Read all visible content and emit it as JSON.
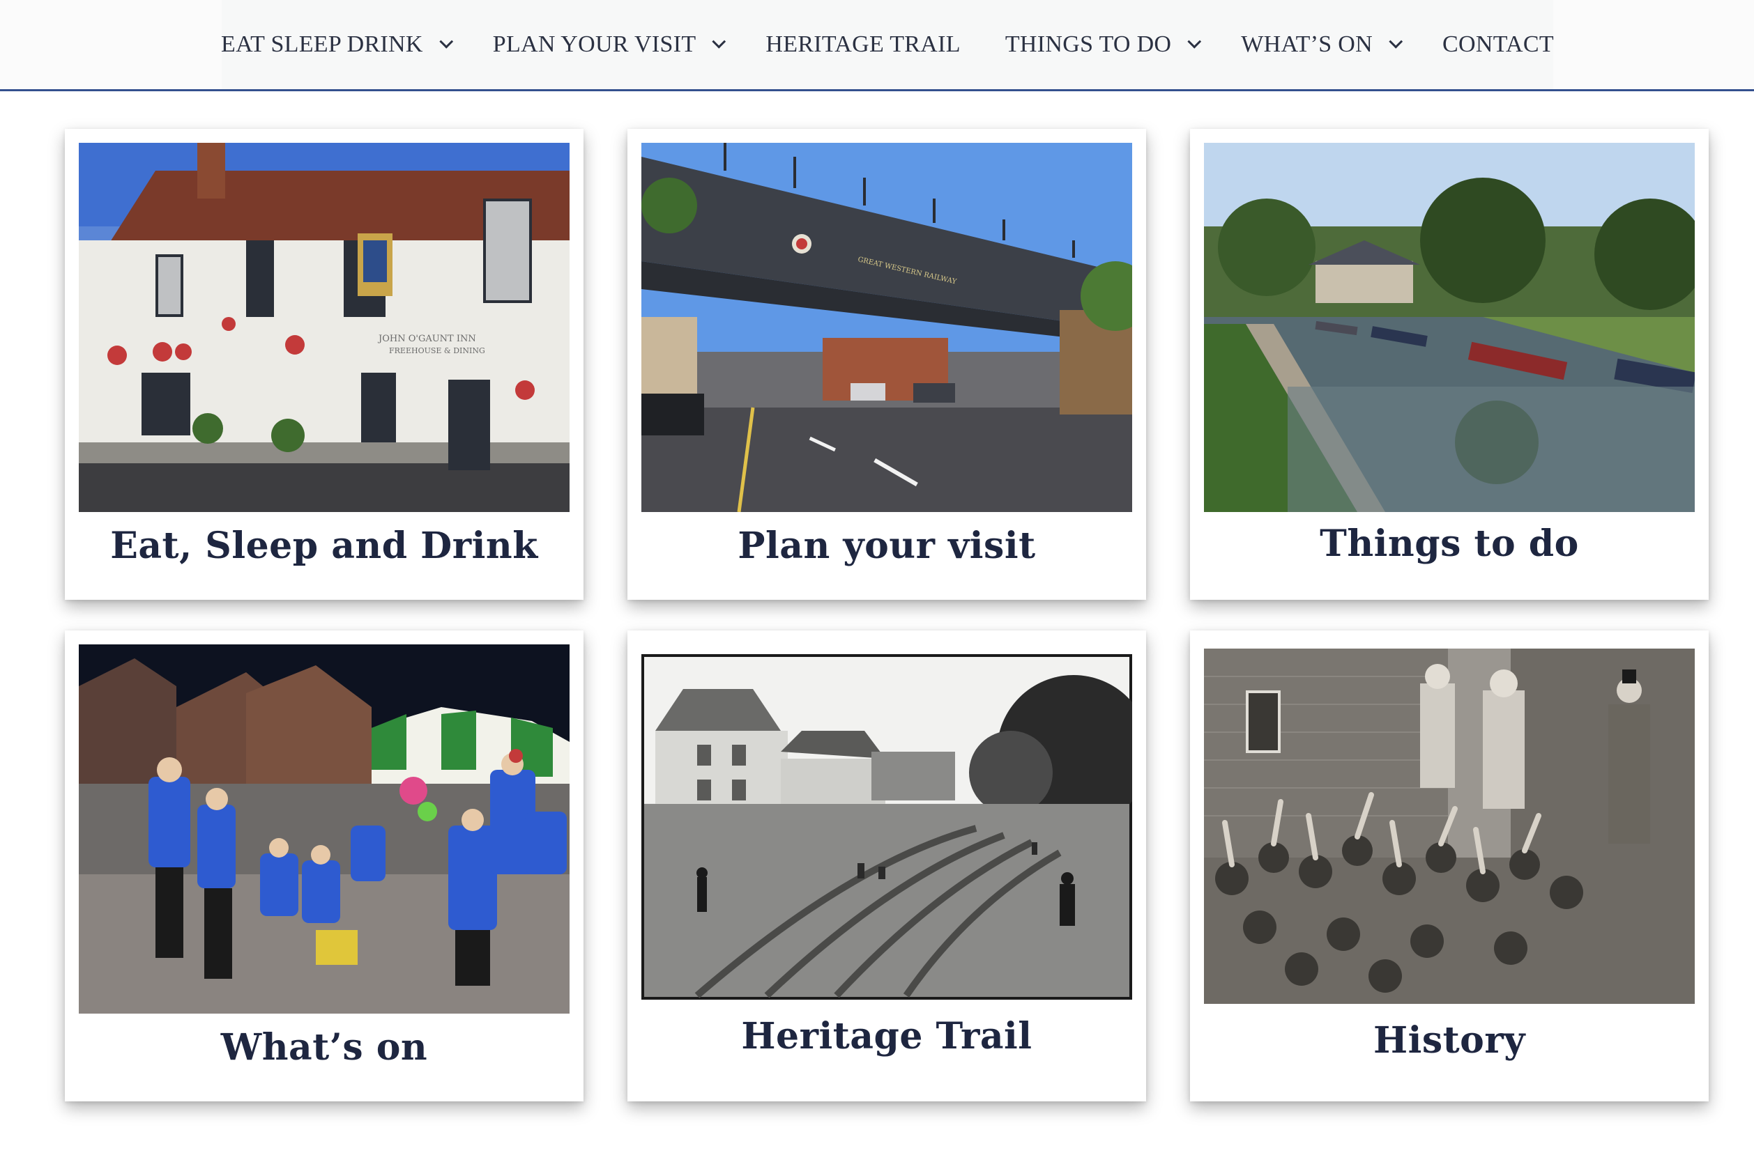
{
  "nav": {
    "items": [
      {
        "label": "EAT SLEEP DRINK",
        "has_dropdown": true
      },
      {
        "label": "PLAN YOUR VISIT",
        "has_dropdown": true
      },
      {
        "label": "HERITAGE TRAIL",
        "has_dropdown": false
      },
      {
        "label": "THINGS TO DO",
        "has_dropdown": true
      },
      {
        "label": "WHAT’S ON",
        "has_dropdown": true
      },
      {
        "label": "CONTACT",
        "has_dropdown": false
      }
    ]
  },
  "cards": [
    {
      "title": "Eat, Sleep and Drink",
      "image": "inn-photo"
    },
    {
      "title": "Plan your visit",
      "image": "railway-bridge-photo"
    },
    {
      "title": "Things to do",
      "image": "canal-photo"
    },
    {
      "title": "What’s on",
      "image": "brass-band-photo"
    },
    {
      "title": "Heritage Trail",
      "image": "historic-village-photo"
    },
    {
      "title": "History",
      "image": "historic-crowd-photo"
    }
  ],
  "photo_text": {
    "inn_sign": "JOHN O'GAUNT INN",
    "inn_sub": "FREEHOUSE & DINING",
    "bridge_sign": "GREAT WESTERN RAILWAY"
  },
  "colors": {
    "nav_border": "#34508e",
    "title_text": "#1e2640",
    "nav_text": "#2b3142"
  }
}
